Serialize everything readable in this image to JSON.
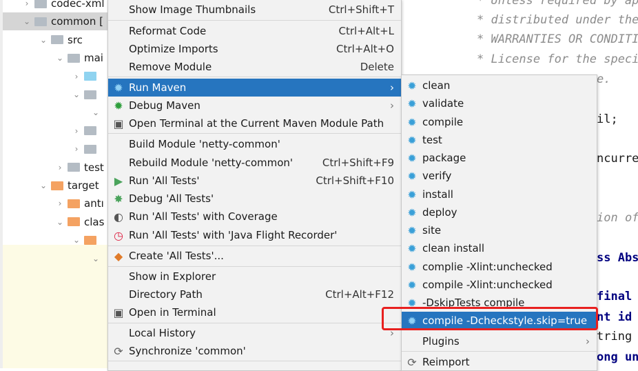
{
  "tree": [
    {
      "label": "codec-xml",
      "chevron": "right",
      "folder": "module"
    },
    {
      "label": "common [",
      "chevron": "down",
      "folder": "module",
      "selected": true
    },
    {
      "label": "src",
      "chevron": "down",
      "folder": "gray"
    },
    {
      "label": "mai",
      "chevron": "down",
      "folder": "gray"
    },
    {
      "label": "",
      "chevron": "right",
      "folder": "blue"
    },
    {
      "label": "",
      "chevron": "down",
      "folder": "gray"
    },
    {
      "label": "",
      "chevron": "down",
      "folder": "none"
    },
    {
      "label": "",
      "chevron": "right",
      "folder": "gray"
    },
    {
      "label": "",
      "chevron": "right",
      "folder": "gray"
    },
    {
      "label": "test",
      "chevron": "right",
      "folder": "gray"
    },
    {
      "label": "target",
      "chevron": "down",
      "folder": "orange"
    },
    {
      "label": "antı",
      "chevron": "right",
      "folder": "orange"
    },
    {
      "label": "clas",
      "chevron": "down",
      "folder": "orange"
    },
    {
      "label": "",
      "chevron": "down",
      "folder": "orange"
    },
    {
      "label": "",
      "chevron": "down",
      "folder": "none"
    }
  ],
  "code": [
    {
      "text": "* Unless required by app",
      "cls": "cm"
    },
    {
      "text": "* distributed under the",
      "cls": "cm"
    },
    {
      "text": "* WARRANTIES OR CONDITIO",
      "cls": "cm"
    },
    {
      "text": "* License for the speci",
      "cls": "cm"
    },
    {
      "text": "e.",
      "cls": "cm"
    },
    {
      "text": "il;",
      "cls": ""
    },
    {
      "text": "ncurre",
      "cls": ""
    },
    {
      "text": "ion of",
      "cls": "cm"
    },
    {
      "text": "ss Abs",
      "cls": "kw"
    },
    {
      "text": "final",
      "cls": "kw"
    },
    {
      "text": "nt id",
      "cls": "kw"
    },
    {
      "text": "tring",
      "cls": ""
    },
    {
      "text": "ong un",
      "cls": "kw"
    }
  ],
  "context_menu": [
    {
      "label": "Show Image Thumbnails",
      "shortcut": "Ctrl+Shift+T"
    },
    {
      "label": "Reformat Code",
      "shortcut": "Ctrl+Alt+L"
    },
    {
      "label": "Optimize Imports",
      "shortcut": "Ctrl+Alt+O"
    },
    {
      "label": "Remove Module",
      "shortcut": "Delete"
    },
    {
      "label": "Run Maven",
      "icon": "gear-icon",
      "submenu": true,
      "highlighted": true
    },
    {
      "label": "Debug Maven",
      "icon": "debug-gear-icon",
      "submenu": true
    },
    {
      "label": "Open Terminal at the Current Maven Module Path",
      "icon": "terminal-icon"
    },
    {
      "label": "Build Module 'netty-common'"
    },
    {
      "label": "Rebuild Module 'netty-common'",
      "shortcut": "Ctrl+Shift+F9"
    },
    {
      "label": "Run 'All Tests'",
      "icon": "run-icon",
      "shortcut": "Ctrl+Shift+F10"
    },
    {
      "label": "Debug 'All Tests'",
      "icon": "bug-icon"
    },
    {
      "label": "Run 'All Tests' with Coverage",
      "icon": "coverage-icon"
    },
    {
      "label": "Run 'All Tests' with 'Java Flight Recorder'",
      "icon": "profiler-icon"
    },
    {
      "label": "Create 'All Tests'...",
      "icon": "create-config-icon"
    },
    {
      "label": "Show in Explorer"
    },
    {
      "label": "Directory Path",
      "shortcut": "Ctrl+Alt+F12"
    },
    {
      "label": "Open in Terminal",
      "icon": "terminal-icon"
    },
    {
      "label": "Local History",
      "submenu": true
    },
    {
      "label": "Synchronize 'common'",
      "icon": "sync-icon"
    }
  ],
  "run_maven_submenu": [
    {
      "label": "clean"
    },
    {
      "label": "validate"
    },
    {
      "label": "compile"
    },
    {
      "label": "test"
    },
    {
      "label": "package"
    },
    {
      "label": "verify"
    },
    {
      "label": "install"
    },
    {
      "label": "deploy"
    },
    {
      "label": "site"
    },
    {
      "label": "clean install"
    },
    {
      "label": "complie -Xlint:unchecked"
    },
    {
      "label": "compile -Xlint:unchecked"
    },
    {
      "label": "-DskipTests compile"
    },
    {
      "label": "compile -Dcheckstyle.skip=true",
      "highlighted": true
    },
    {
      "label": "Plugins",
      "submenu": true,
      "noicon": true
    },
    {
      "label": "Reimport",
      "icon": "sync-icon"
    }
  ],
  "colors": {
    "highlight": "#2675bf",
    "annotation": "#e8201f",
    "gear": "#3aa0d8"
  }
}
